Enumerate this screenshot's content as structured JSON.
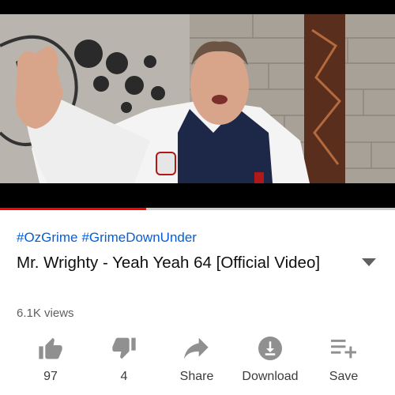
{
  "video": {
    "progress_fraction": 0.37
  },
  "info": {
    "hashtags": [
      "#OzGrime",
      "#GrimeDownUnder"
    ],
    "title": "Mr. Wrighty - Yeah Yeah 64 [Official Video]",
    "views": "6.1K views"
  },
  "actions": {
    "like": "97",
    "dislike": "4",
    "share": "Share",
    "download": "Download",
    "save": "Save"
  },
  "colors": {
    "hashtag": "#065fd4",
    "progress": "#ff0000",
    "icon": "#909090",
    "text": "#0f0f0f"
  }
}
